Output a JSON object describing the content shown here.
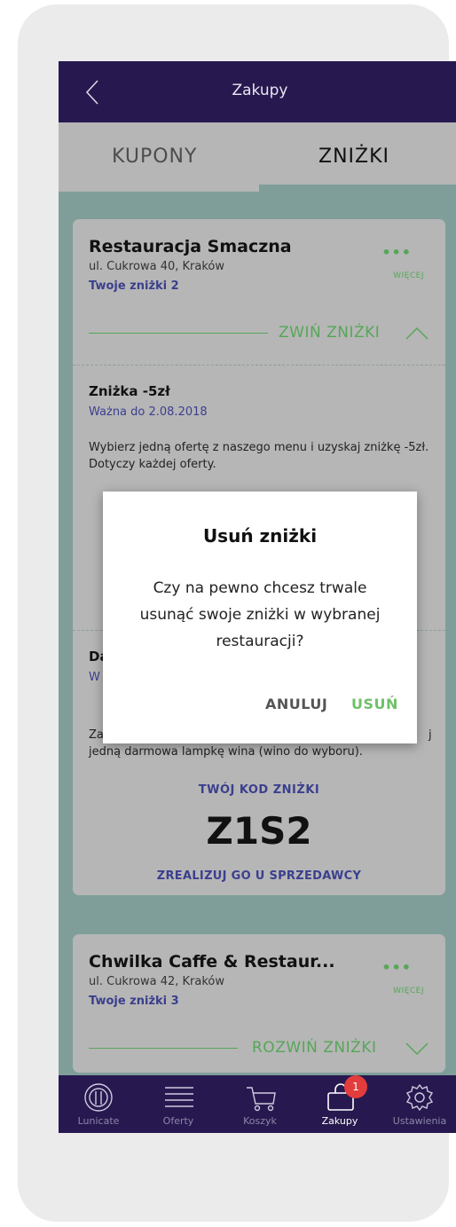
{
  "header": {
    "title": "Zakupy",
    "back_icon": "chevron-left-icon"
  },
  "tabs": [
    {
      "label": "KUPONY",
      "active": false
    },
    {
      "label": "ZNIŻKI",
      "active": true
    }
  ],
  "restaurants": [
    {
      "name": "Restauracja Smaczna",
      "address": "ul. Cukrowa 40, Kraków",
      "discount_count": "Twoje zniżki 2",
      "more_label": "WIĘCEJ",
      "toggle_label": "ZWIŃ ZNIŻKI",
      "discounts": [
        {
          "title": "Zniżka -5zł",
          "valid": "Ważna do 2.08.2018",
          "description": "Wybierz jedną ofertę z naszego menu i uzyskaj zniżkę -5zł. Dotyczy każdej oferty."
        },
        {
          "title_partial": "Da",
          "valid_partial": "W",
          "description_partial_1": "Za",
          "description_partial_1_end": "j",
          "description_line_2": "jedną darmowa lampkę wina (wino do wyboru).",
          "code_label": "TWÓJ KOD ZNIŻKI",
          "code": "Z1S2",
          "redeem_label": "ZREALIZUJ GO U SPRZEDAWCY"
        }
      ]
    },
    {
      "name": "Chwilka Caffe & Restaur...",
      "address": "ul. Cukrowa 42, Kraków",
      "discount_count": "Twoje zniżki 3",
      "more_label": "WIĘCEJ",
      "toggle_label": "ROZWIŃ ZNIŻKI"
    }
  ],
  "dialog": {
    "title": "Usuń zniżki",
    "message": "Czy na pewno chcesz trwale usunąć swoje zniżki w wybranej restauracji?",
    "cancel": "ANULUJ",
    "confirm": "USUŃ"
  },
  "bottom_nav": [
    {
      "label": "Lunicate",
      "icon": "plate-cutlery-icon",
      "active": false
    },
    {
      "label": "Oferty",
      "icon": "list-icon",
      "active": false
    },
    {
      "label": "Koszyk",
      "icon": "cart-icon",
      "active": false
    },
    {
      "label": "Zakupy",
      "icon": "shopping-bag-icon",
      "active": true,
      "badge": "1"
    },
    {
      "label": "Ustawienia",
      "icon": "gear-icon",
      "active": false
    }
  ],
  "colors": {
    "header": "#27194f",
    "accent_green": "#57a658",
    "link_blue": "#3b3f8e",
    "badge_red": "#e23c3c"
  }
}
